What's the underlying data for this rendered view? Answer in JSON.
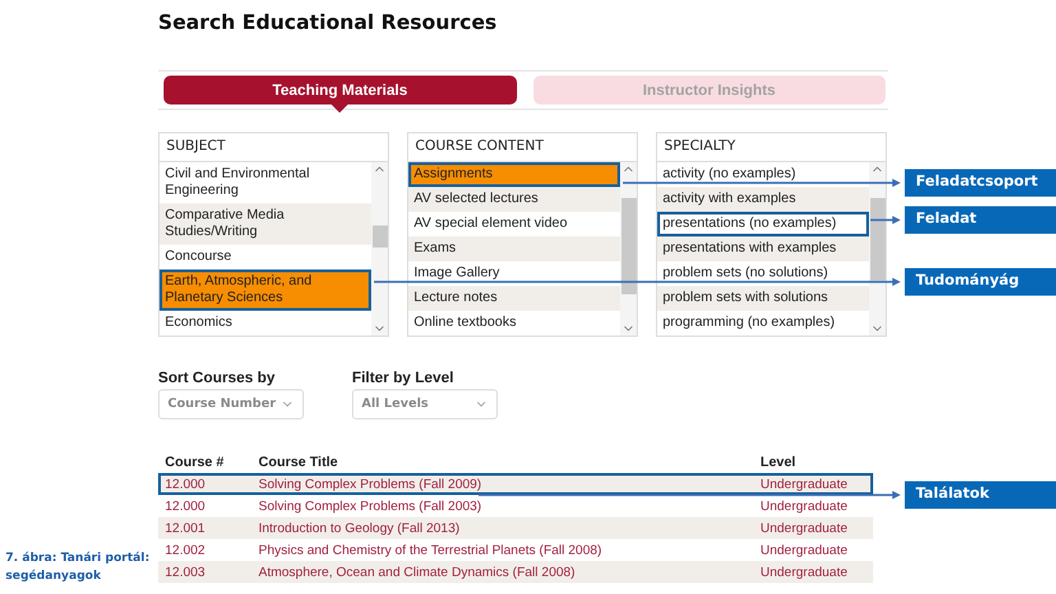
{
  "page_title": "Search Educational Resources",
  "tabs": [
    {
      "label": "Teaching Materials",
      "selected": true
    },
    {
      "label": "Instructor Insights",
      "selected": false
    }
  ],
  "lists": [
    {
      "heading": "SUBJECT",
      "items": [
        {
          "label": "Civil and Environmental Engineering",
          "selected": false,
          "highlighted": false
        },
        {
          "label": "Comparative Media Studies/Writing",
          "selected": false,
          "highlighted": false
        },
        {
          "label": "Concourse",
          "selected": false,
          "highlighted": false
        },
        {
          "label": "Earth, Atmospheric, and Planetary Sciences",
          "selected": true,
          "highlighted": true
        },
        {
          "label": "Economics",
          "selected": false,
          "highlighted": false
        }
      ]
    },
    {
      "heading": "COURSE CONTENT",
      "items": [
        {
          "label": "Assignments",
          "selected": true,
          "highlighted": true
        },
        {
          "label": "AV selected lectures",
          "selected": false,
          "highlighted": false
        },
        {
          "label": "AV special element video",
          "selected": false,
          "highlighted": false
        },
        {
          "label": "Exams",
          "selected": false,
          "highlighted": false
        },
        {
          "label": "Image Gallery",
          "selected": false,
          "highlighted": false
        },
        {
          "label": "Lecture notes",
          "selected": false,
          "highlighted": false
        },
        {
          "label": "Online textbooks",
          "selected": false,
          "highlighted": false
        }
      ]
    },
    {
      "heading": "SPECIALTY",
      "items": [
        {
          "label": "activity (no examples)",
          "selected": false,
          "highlighted": false
        },
        {
          "label": "activity with examples",
          "selected": false,
          "highlighted": false
        },
        {
          "label": "presentations (no examples)",
          "selected": false,
          "highlighted": true
        },
        {
          "label": "presentations with examples",
          "selected": false,
          "highlighted": false
        },
        {
          "label": "problem sets (no solutions)",
          "selected": false,
          "highlighted": false
        },
        {
          "label": "problem sets with solutions",
          "selected": false,
          "highlighted": false
        },
        {
          "label": "programming (no examples)",
          "selected": false,
          "highlighted": false
        }
      ]
    }
  ],
  "sort": {
    "label": "Sort Courses by",
    "value": "Course Number"
  },
  "filter": {
    "label": "Filter by Level",
    "value": "All Levels"
  },
  "results": {
    "columns": [
      "Course #",
      "Course Title",
      "Level"
    ],
    "rows": [
      {
        "cells": [
          "12.000",
          "Solving Complex Problems (Fall 2009)",
          "Undergraduate"
        ],
        "highlighted": true
      },
      {
        "cells": [
          "12.000",
          "Solving Complex Problems (Fall 2003)",
          "Undergraduate"
        ],
        "highlighted": false
      },
      {
        "cells": [
          "12.001",
          "Introduction to Geology (Fall 2013)",
          "Undergraduate"
        ],
        "highlighted": false
      },
      {
        "cells": [
          "12.002",
          "Physics and Chemistry of the Terrestrial Planets (Fall 2008)",
          "Undergraduate"
        ],
        "highlighted": false
      },
      {
        "cells": [
          "12.003",
          "Atmosphere, Ocean and Climate Dynamics (Fall 2008)",
          "Undergraduate"
        ],
        "highlighted": false
      }
    ]
  },
  "annotations": [
    {
      "label": "Feladatcsoport"
    },
    {
      "label": "Feladat"
    },
    {
      "label": "Tudományág"
    },
    {
      "label": "Találatok"
    }
  ],
  "caption": "7. ábra: Tanári portál: segédanyagok"
}
